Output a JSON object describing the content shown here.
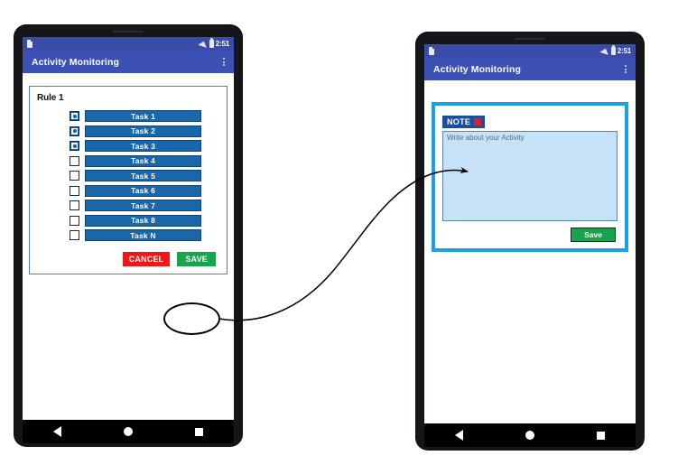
{
  "status_bar": {
    "time": "2:51",
    "sim_icon": "sim-card-icon",
    "wifi_icon": "wifi-signal-icon",
    "battery_icon": "battery-icon"
  },
  "app_bar": {
    "title": "Activity Monitoring",
    "overflow_icon": "overflow-menu-icon"
  },
  "left_screen": {
    "card": {
      "title": "Rule 1",
      "tasks": [
        {
          "label": "Task 1",
          "checked": true
        },
        {
          "label": "Task 2",
          "checked": true
        },
        {
          "label": "Task 3",
          "checked": true
        },
        {
          "label": "Task 4",
          "checked": false
        },
        {
          "label": "Task 5",
          "checked": false
        },
        {
          "label": "Task 6",
          "checked": false
        },
        {
          "label": "Task 7",
          "checked": false
        },
        {
          "label": "Task 8",
          "checked": false
        },
        {
          "label": "Task N",
          "checked": false
        }
      ],
      "cancel_label": "CANCEL",
      "save_label": "SAVE"
    }
  },
  "right_screen": {
    "dialog": {
      "tag_label": "NOTE",
      "close_icon": "close-badge-icon",
      "textarea_placeholder": "Write about your Activity",
      "textarea_value": "",
      "save_label": "Save"
    }
  },
  "nav_bar": {
    "back_icon": "back-triangle-icon",
    "home_icon": "home-circle-icon",
    "recents_icon": "recents-square-icon"
  },
  "annotations": {
    "highlight_target": "SAVE",
    "flow_arrow": "curved-flow-arrow"
  },
  "colors": {
    "app_bar": "#3d51b5",
    "status_bar": "#3a4ba8",
    "task_button": "#1a66ab",
    "cancel": "#f0161a",
    "save": "#16a44d",
    "dialog_border": "#1ba1e2",
    "textarea": "#c7e2f7",
    "note_tag": "#1b4f9c",
    "note_close": "#d2232a"
  }
}
